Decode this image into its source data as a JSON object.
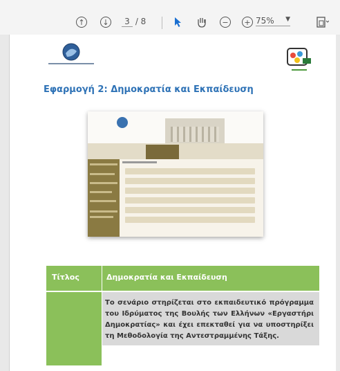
{
  "toolbar": {
    "current_page": "3",
    "page_total": "/ 8",
    "zoom": "75%"
  },
  "document": {
    "heading": "Εφαρμογή 2: Δημοκρατία και Εκπαίδευση",
    "table": {
      "header_left": "Τίτλος",
      "header_right": "Δημοκρατία και Εκπαίδευση",
      "body_text": "Το σενάριο στηρίζεται στο εκπαιδευτικό πρόγραμμα του Ιδρύματος της Βουλής των Ελλήνων «Εργαστήρι Δημοκρατίας» και έχει επεκταθεί για να υποστηρίξει τη Μεθοδολογία της Αντεστραμμένης Τάξης."
    }
  }
}
